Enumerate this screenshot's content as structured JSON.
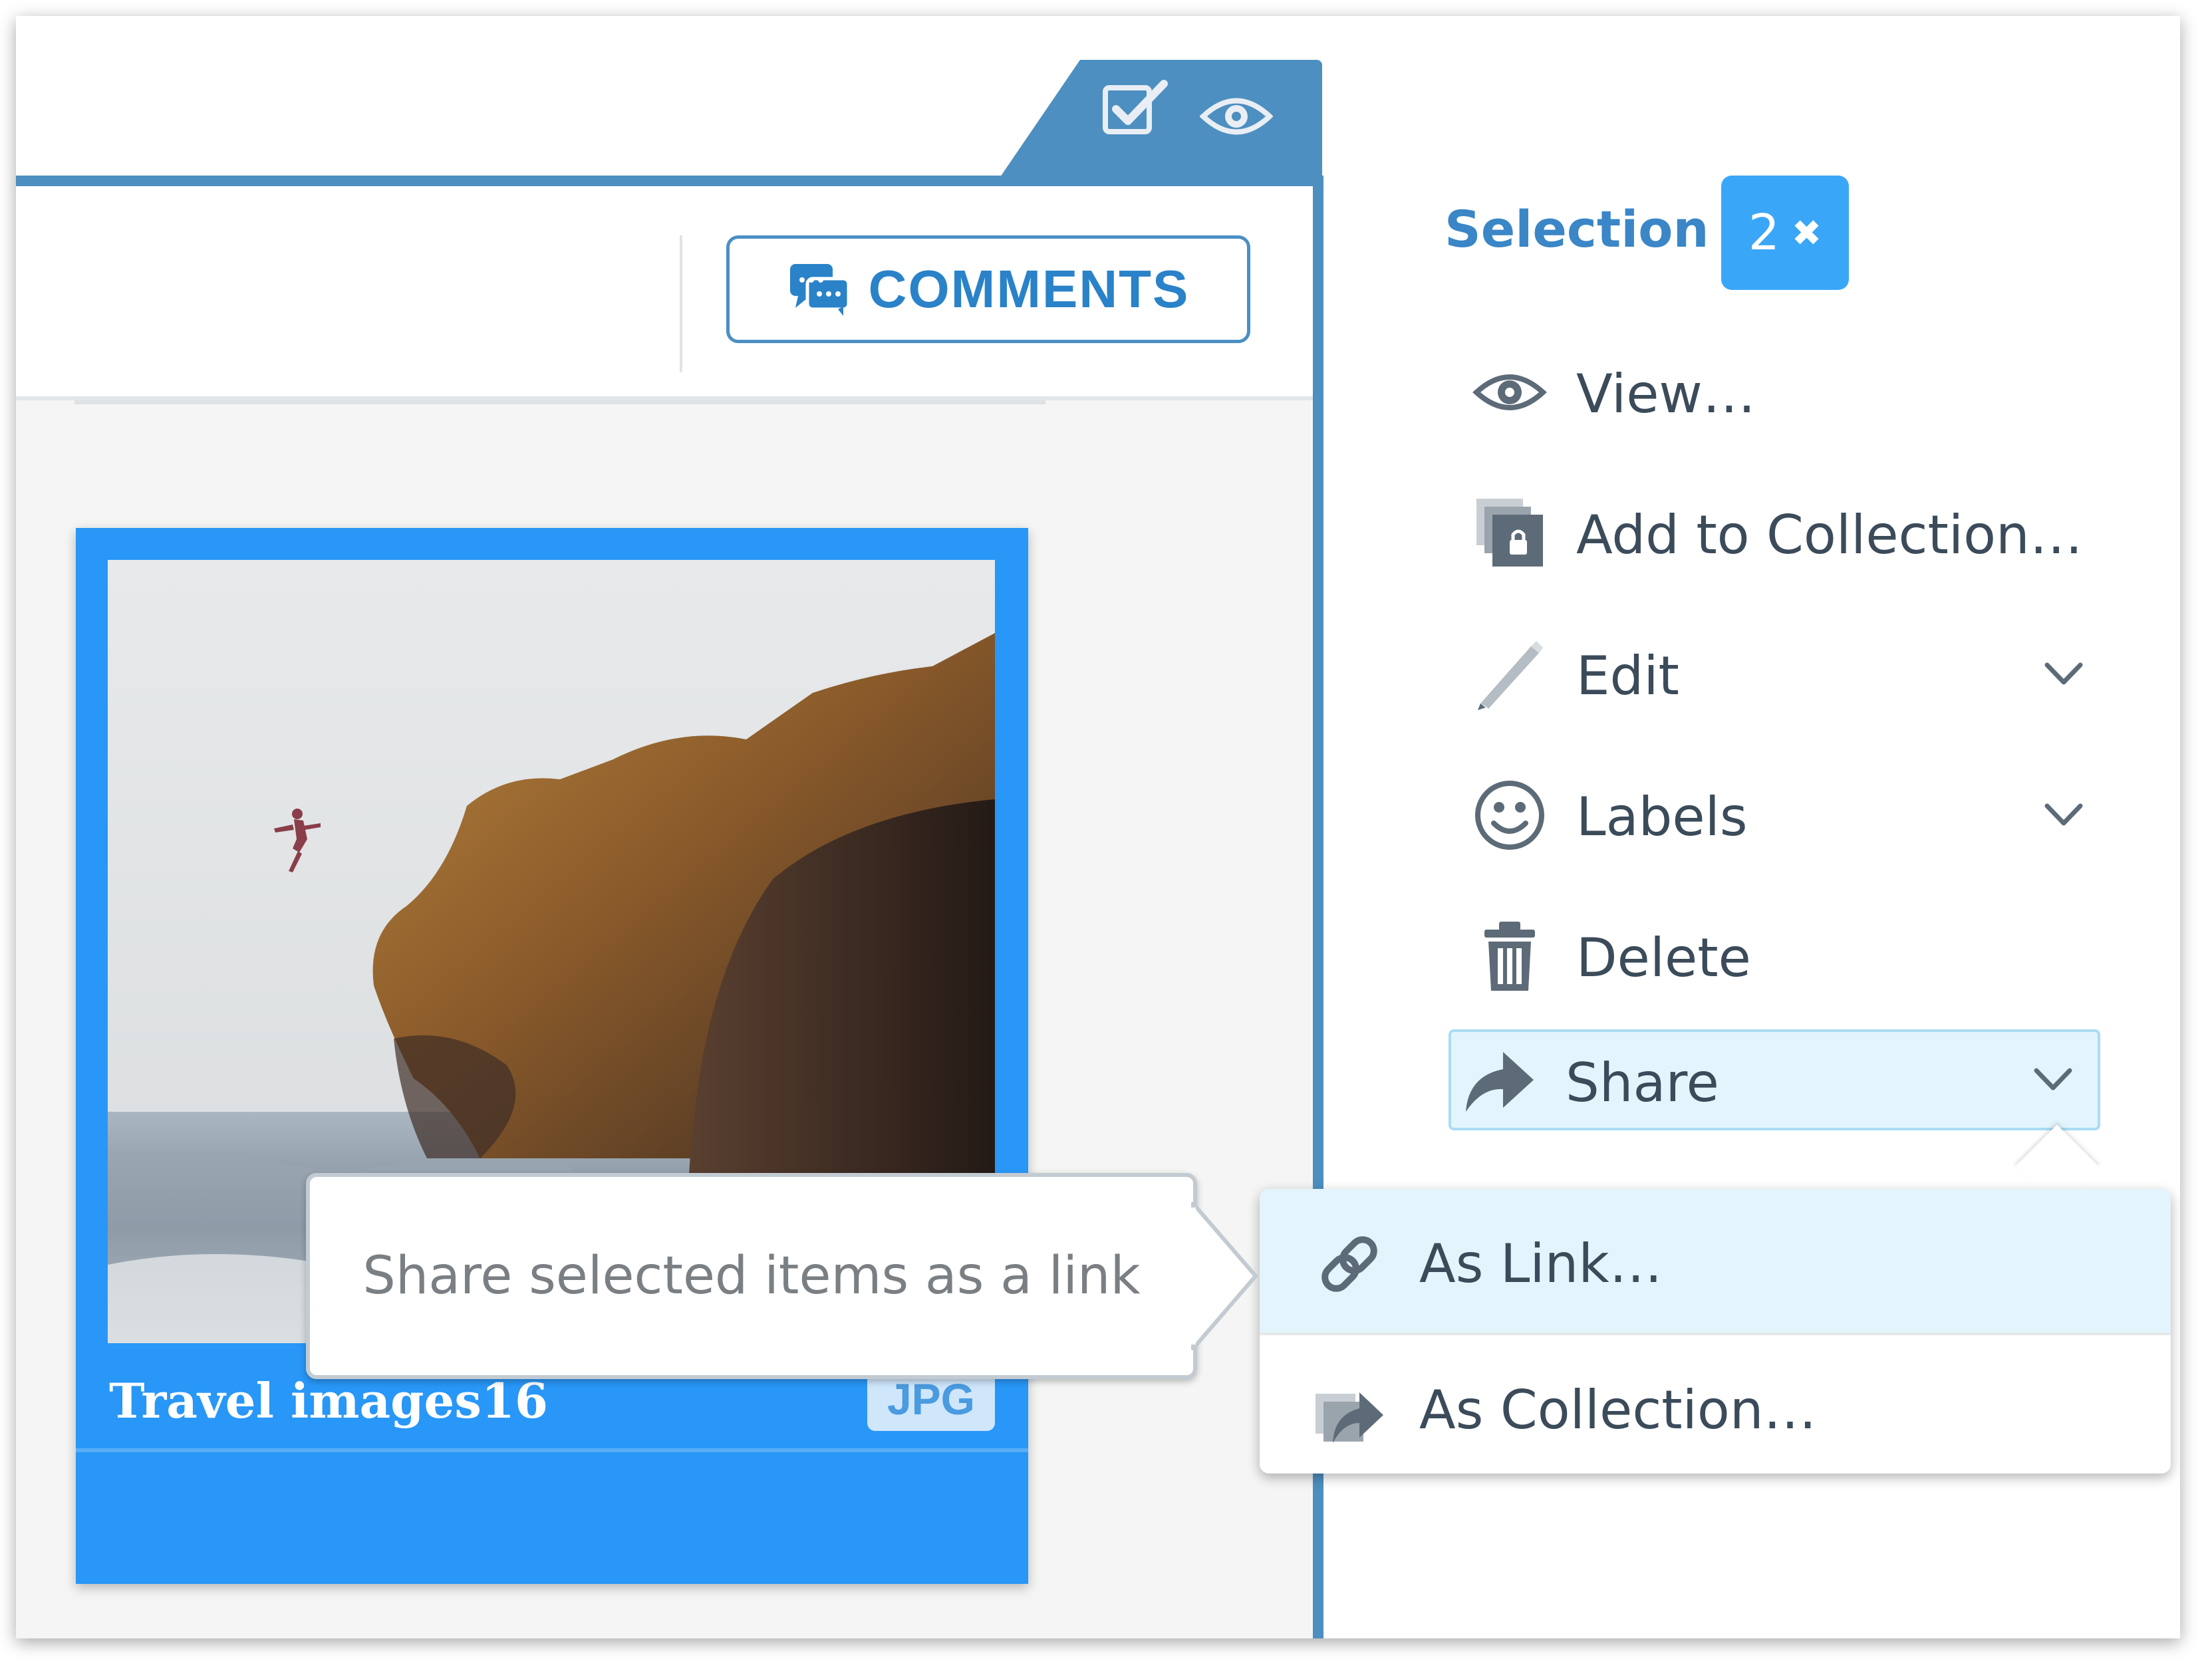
{
  "toolbar": {
    "comments_label": "COMMENTS"
  },
  "selection": {
    "title": "Selection",
    "count": "2",
    "clear_glyph": "✖"
  },
  "actions": [
    {
      "label": "View…",
      "icon": "eye-icon"
    },
    {
      "label": "Add to Collection…",
      "icon": "add-to-collection-icon"
    },
    {
      "label": "Edit",
      "icon": "pencil-icon",
      "has_submenu": true
    },
    {
      "label": "Labels",
      "icon": "smiley-icon",
      "has_submenu": true
    },
    {
      "label": "Delete",
      "icon": "trash-icon"
    },
    {
      "label": "Share",
      "icon": "share-arrow-icon",
      "has_submenu": true,
      "active": true
    }
  ],
  "share_menu": [
    {
      "label": "As Link…",
      "icon": "link-icon",
      "highlighted": true
    },
    {
      "label": "As Collection…",
      "icon": "share-collection-icon"
    }
  ],
  "tooltip": {
    "text": "Share selected items as a link"
  },
  "card": {
    "title": "Travel images16",
    "file_type": "JPG"
  },
  "colors": {
    "accent": "#2897f7",
    "panel_blue": "#4d8fc0",
    "menu_text": "#3b4b5a",
    "highlight": "#e3f4fc"
  }
}
